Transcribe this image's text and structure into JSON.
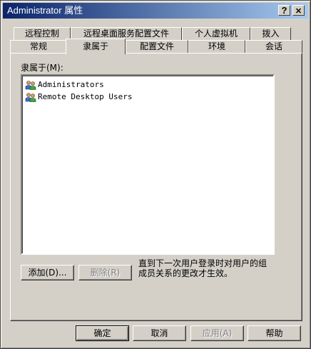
{
  "window": {
    "title": "Administrator 属性",
    "help_button": "?",
    "close_button": "✕"
  },
  "tabs_back": [
    {
      "label": "远程控制"
    },
    {
      "label": "远程桌面服务配置文件"
    },
    {
      "label": "个人虚拟机"
    },
    {
      "label": "拨入"
    }
  ],
  "tabs_front": [
    {
      "label": "常规"
    },
    {
      "label": "隶属于",
      "active": true
    },
    {
      "label": "配置文件"
    },
    {
      "label": "环境"
    },
    {
      "label": "会话"
    }
  ],
  "member_of": {
    "label": "隶属于(M):",
    "items": [
      {
        "name": "Administrators",
        "icon": "group-icon"
      },
      {
        "name": "Remote Desktop Users",
        "icon": "group-icon"
      }
    ],
    "add_label": "添加(D)...",
    "remove_label": "删除(R)",
    "note": "直到下一次用户登录时对用户的组成员关系的更改才生效。"
  },
  "footer": {
    "ok_label": "确定",
    "cancel_label": "取消",
    "apply_label": "应用(A)",
    "help_label": "帮助"
  }
}
